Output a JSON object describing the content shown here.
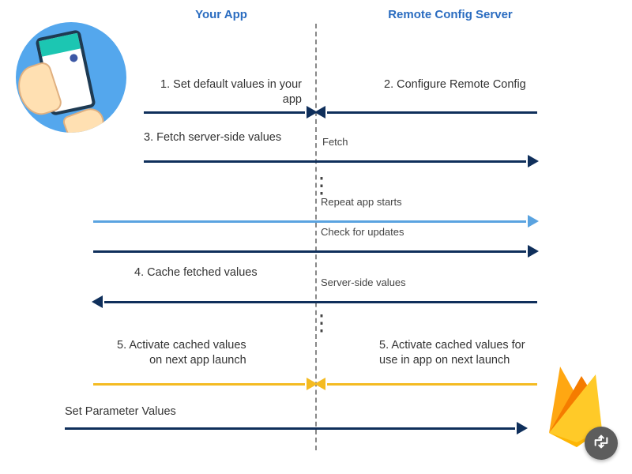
{
  "titles": {
    "left": "Your App",
    "right": "Remote Config Server"
  },
  "steps": {
    "s1": "1. Set default values in your app",
    "s2": "2. Configure Remote Config",
    "s3": "3. Fetch server-side values",
    "s4": "4. Cache fetched values",
    "s5a": "5. Activate cached values\non next app launch",
    "s5b": "5. Activate cached values for\nuse in app on next launch"
  },
  "arrows": {
    "fetch": "Fetch",
    "repeat_starts": "Repeat app starts",
    "check_updates": "Check for updates",
    "server_values": "Server-side values",
    "set_param": "Set Parameter Values"
  },
  "icons": {
    "app": "phone-in-hand-icon",
    "firebase": "firebase-logo-icon",
    "fab": "path-arrows-icon"
  }
}
